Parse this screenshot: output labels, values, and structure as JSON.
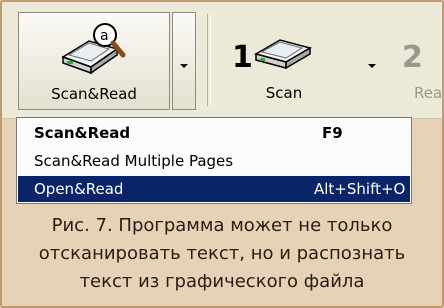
{
  "toolbar": {
    "scanread_label": "Scan&Read",
    "scan_number": "1",
    "scan_label": "Scan",
    "read_number": "2",
    "read_label_partial": "Rea"
  },
  "menu": {
    "items": [
      {
        "label": "Scan&Read",
        "shortcut": "F9",
        "bold": true,
        "selected": false
      },
      {
        "label": "Scan&Read Multiple Pages",
        "shortcut": "",
        "bold": false,
        "selected": false
      },
      {
        "label": "Open&Read",
        "shortcut": "Alt+Shift+O",
        "bold": false,
        "selected": true
      }
    ]
  },
  "caption": {
    "line1": "Рис. 7. Программа может не только",
    "line2": "отсканировать текст, но и распознать",
    "line3": "текст из графического файла"
  },
  "colors": {
    "page_background": "#e6d2b7",
    "toolbar_background": "#ece9d8",
    "menu_selection": "#0a246a"
  },
  "icons": [
    "scanner-magnifier-icon",
    "scanner-icon",
    "dropdown-arrow-icon"
  ]
}
